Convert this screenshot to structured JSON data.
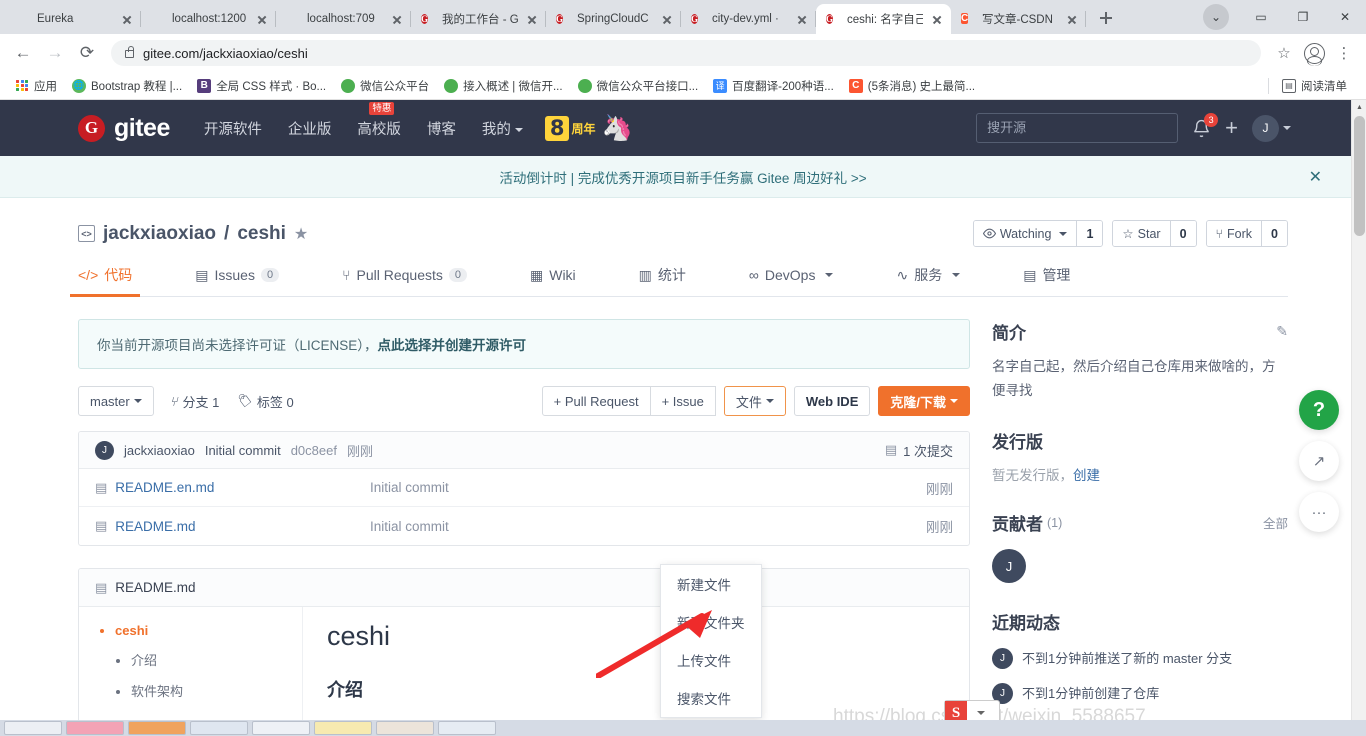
{
  "browser": {
    "tabs": [
      {
        "title": "Eureka",
        "favicon": "leaf-icon",
        "active": false
      },
      {
        "title": "localhost:1200",
        "favicon": "leaf-icon",
        "active": false
      },
      {
        "title": "localhost:709",
        "favicon": "leaf-icon",
        "active": false
      },
      {
        "title": "我的工作台 - G",
        "favicon": "gitee-icon",
        "active": false
      },
      {
        "title": "SpringCloudC",
        "favicon": "gitee-icon",
        "active": false
      },
      {
        "title": "city-dev.yml ·",
        "favicon": "gitee-icon",
        "active": false
      },
      {
        "title": "ceshi: 名字自己",
        "favicon": "gitee-icon",
        "active": true
      },
      {
        "title": "写文章-CSDN",
        "favicon": "csdn-icon",
        "active": false
      }
    ],
    "new_tab_label": "+",
    "window_controls": [
      "minimize",
      "maximize",
      "close"
    ],
    "address": "gitee.com/jackxiaoxiao/ceshi",
    "nav": {
      "back": "back-icon",
      "forward": "forward-icon",
      "reload": "reload-icon"
    },
    "bookmarks": [
      {
        "label": "应用",
        "icon": "apps-grid-icon"
      },
      {
        "label": "Bootstrap 教程 |...",
        "icon": "bootstrap-site-icon"
      },
      {
        "label": "全局 CSS 样式 · Bo...",
        "icon": "bootstrap-b-icon"
      },
      {
        "label": "微信公众平台",
        "icon": "wechat-icon"
      },
      {
        "label": "接入概述 | 微信开...",
        "icon": "wechat-icon"
      },
      {
        "label": "微信公众平台接口...",
        "icon": "wechat-icon"
      },
      {
        "label": "百度翻译-200种语...",
        "icon": "baidu-translate-icon"
      },
      {
        "label": "(5条消息) 史上最简...",
        "icon": "csdn-icon"
      }
    ],
    "reading_list": "阅读清单"
  },
  "gitee_nav": {
    "logo_mark": "G",
    "logo_text": "gitee",
    "items": [
      {
        "label": "开源软件",
        "badge": null,
        "caret": false
      },
      {
        "label": "企业版",
        "badge": null,
        "caret": false
      },
      {
        "label": "高校版",
        "badge": "特惠",
        "caret": false
      },
      {
        "label": "博客",
        "badge": null,
        "caret": false
      },
      {
        "label": "我的",
        "badge": null,
        "caret": true
      }
    ],
    "anniversary_number": "8",
    "anniversary_text": "周年",
    "search_placeholder": "搜开源",
    "notification_count": "3",
    "plus_label": "+",
    "avatar_initial": "J"
  },
  "announcement": {
    "text": "活动倒计时 | 完成优秀开源项目新手任务赢 Gitee 周边好礼 >>",
    "close": "✕"
  },
  "repo": {
    "owner": "jackxiaoxiao",
    "separator": "/",
    "name": "ceshi",
    "actions": [
      {
        "label": "Watching",
        "count": "1",
        "icon": "eye-icon",
        "caret": true
      },
      {
        "label": "Star",
        "count": "0",
        "icon": "star-icon",
        "caret": false
      },
      {
        "label": "Fork",
        "count": "0",
        "icon": "fork-icon",
        "caret": false
      }
    ],
    "tabs": [
      {
        "label": "代码",
        "icon": "code-icon",
        "count": null,
        "active": true,
        "caret": false
      },
      {
        "label": "Issues",
        "icon": "issues-icon",
        "count": "0",
        "active": false,
        "caret": false
      },
      {
        "label": "Pull Requests",
        "icon": "pr-icon",
        "count": "0",
        "active": false,
        "caret": false
      },
      {
        "label": "Wiki",
        "icon": "wiki-icon",
        "count": null,
        "active": false,
        "caret": false
      },
      {
        "label": "统计",
        "icon": "chart-icon",
        "count": null,
        "active": false,
        "caret": false
      },
      {
        "label": "DevOps",
        "icon": "devops-icon",
        "count": null,
        "active": false,
        "caret": true
      },
      {
        "label": "服务",
        "icon": "service-icon",
        "count": null,
        "active": false,
        "caret": true
      },
      {
        "label": "管理",
        "icon": "manage-icon",
        "count": null,
        "active": false,
        "caret": false
      }
    ]
  },
  "license_note": {
    "text": "你当前开源项目尚未选择许可证（LICENSE），",
    "link": "点此选择并创建开源许可"
  },
  "toolbar": {
    "branch": "master",
    "branches_label": "分支 1",
    "tags_label": "标签 0",
    "pull_request": "+ Pull Request",
    "issue": "+ Issue",
    "files": "文件",
    "web_ide": "Web IDE",
    "clone": "克隆/下载"
  },
  "files_dropdown": {
    "items": [
      "新建文件",
      "新建文件夹",
      "上传文件",
      "搜索文件"
    ],
    "highlighted": "上传文件"
  },
  "commit_bar": {
    "avatar_initial": "J",
    "author": "jackxiaoxiao",
    "message": "Initial commit",
    "sha": "d0c8eef",
    "time": "刚刚",
    "commits_count": "1 次提交"
  },
  "file_list": {
    "rows": [
      {
        "name": "README.en.md",
        "message": "Initial commit",
        "time": "刚刚",
        "icon": "file-icon"
      },
      {
        "name": "README.md",
        "message": "Initial commit",
        "time": "刚刚",
        "icon": "file-icon"
      }
    ]
  },
  "readme": {
    "header": "README.md",
    "toc": [
      {
        "label": "ceshi",
        "level": 1
      },
      {
        "label": "介绍",
        "level": 2
      },
      {
        "label": "软件架构",
        "level": 2
      }
    ],
    "h1": "ceshi",
    "h2": "介绍"
  },
  "sidebar": {
    "intro_title": "简介",
    "intro_text": "名字自己起，然后介绍自己仓库用来做啥的，方便寻找",
    "releases_title": "发行版",
    "releases_empty": "暂无发行版，",
    "releases_create": "创建",
    "contributors_title": "贡献者",
    "contributors_count": "(1)",
    "contributors_all": "全部",
    "contributor_initial": "J",
    "activity_title": "近期动态",
    "activity": [
      {
        "avatar": "J",
        "text": "不到1分钟前推送了新的 master 分支"
      },
      {
        "avatar": "J",
        "text": "不到1分钟前创建了仓库"
      }
    ]
  },
  "floating_buttons": [
    {
      "icon": "help-question-icon",
      "label": "?"
    },
    {
      "icon": "share-external-icon",
      "label": "↗"
    },
    {
      "icon": "feedback-chat-icon",
      "label": "···"
    }
  ],
  "watermark": "https://blog.csdn.net/weixin_5588657",
  "popup_app": {
    "initial": "S"
  }
}
